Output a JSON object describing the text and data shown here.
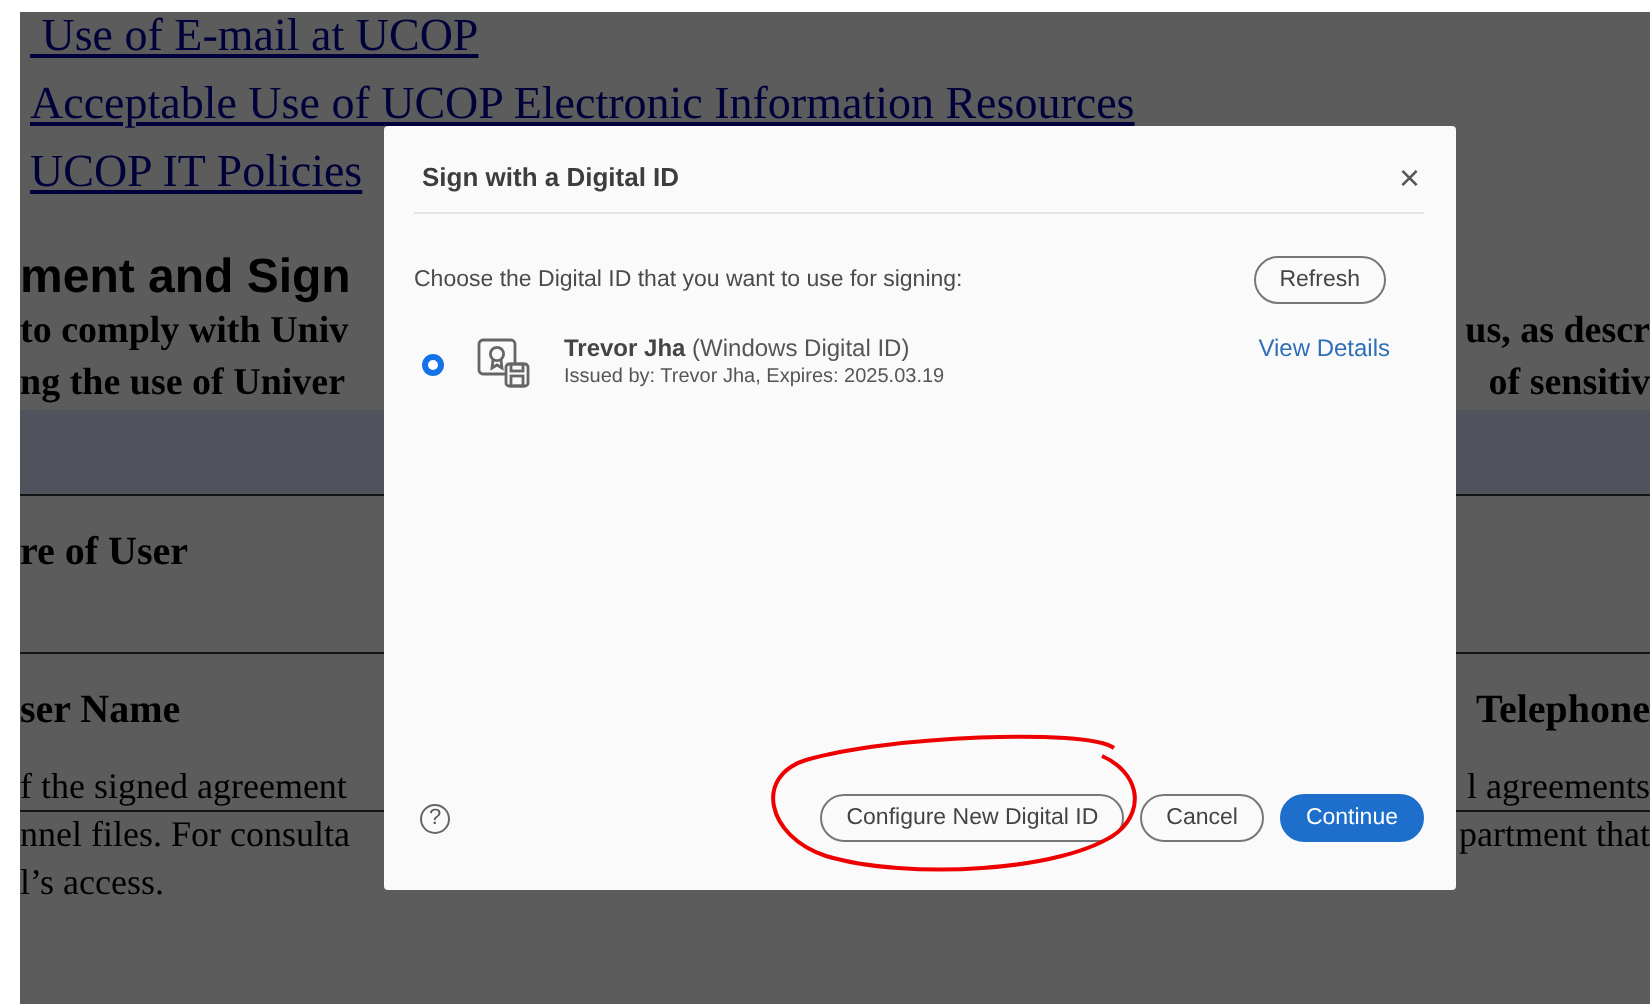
{
  "document": {
    "links": [
      " Use of E-mail at UCOP",
      "Acceptable Use of UCOP Electronic Information Resources",
      "UCOP IT Policies"
    ],
    "heading": "ment and Sign",
    "bold_lines": [
      {
        "left": "to comply with Univ",
        "right": "us, as descr"
      },
      {
        "left": "ng the use of Univer",
        "right": "of sensitiv"
      }
    ],
    "sections": [
      {
        "left": "re of User"
      },
      {
        "left": "ser Name",
        "right": "Telephone"
      }
    ],
    "text_lines": [
      {
        "left": "f the signed agreement",
        "right": "l agreements"
      },
      {
        "left": "nnel files. For consulta",
        "right": "partment that"
      },
      {
        "left": "l’s access."
      }
    ]
  },
  "dialog": {
    "title": "Sign with a Digital ID",
    "close": "×",
    "prompt": "Choose the Digital ID that you want to use for signing:",
    "refresh": "Refresh",
    "ids": [
      {
        "name": "Trevor Jha",
        "type": "(Windows Digital ID)",
        "issued": "Issued by: Trevor Jha, Expires: 2025.03.19",
        "action": "View Details",
        "selected": true
      }
    ],
    "help": "?",
    "buttons": [
      {
        "label": "Configure New Digital ID",
        "kind": "secondary"
      },
      {
        "label": "Cancel",
        "kind": "secondary"
      },
      {
        "label": "Continue",
        "kind": "primary"
      }
    ]
  }
}
